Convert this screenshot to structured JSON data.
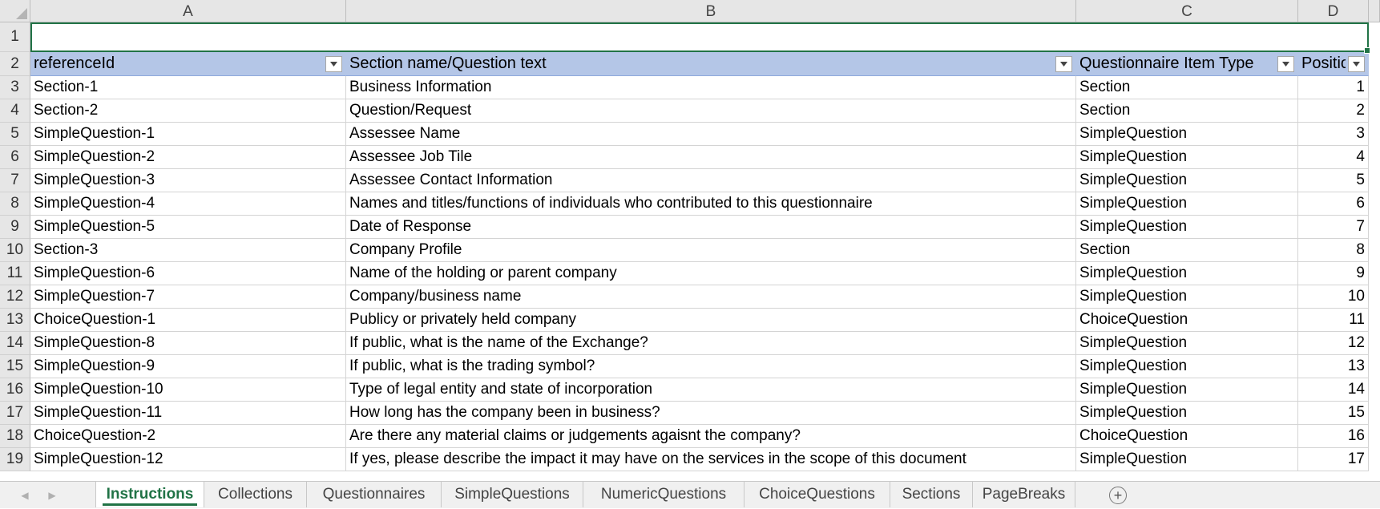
{
  "columns": [
    "A",
    "B",
    "C",
    "D"
  ],
  "header_row": {
    "row_number": "2",
    "cells": [
      "referenceId",
      "Section name/Question text",
      "Questionnaire Item Type",
      "Position"
    ]
  },
  "row1_number": "1",
  "rows": [
    {
      "n": "3",
      "ref": "Section-1",
      "text": "Business Information",
      "type": "Section",
      "pos": "1"
    },
    {
      "n": "4",
      "ref": "Section-2",
      "text": "Question/Request",
      "type": "Section",
      "pos": "2"
    },
    {
      "n": "5",
      "ref": "SimpleQuestion-1",
      "text": "Assessee Name",
      "type": "SimpleQuestion",
      "pos": "3"
    },
    {
      "n": "6",
      "ref": "SimpleQuestion-2",
      "text": "Assessee Job Tile",
      "type": "SimpleQuestion",
      "pos": "4"
    },
    {
      "n": "7",
      "ref": "SimpleQuestion-3",
      "text": "Assessee Contact Information",
      "type": "SimpleQuestion",
      "pos": "5"
    },
    {
      "n": "8",
      "ref": "SimpleQuestion-4",
      "text": "Names and titles/functions of individuals who contributed to this questionnaire",
      "type": "SimpleQuestion",
      "pos": "6"
    },
    {
      "n": "9",
      "ref": "SimpleQuestion-5",
      "text": "Date of Response",
      "type": "SimpleQuestion",
      "pos": "7"
    },
    {
      "n": "10",
      "ref": "Section-3",
      "text": "Company Profile",
      "type": "Section",
      "pos": "8"
    },
    {
      "n": "11",
      "ref": "SimpleQuestion-6",
      "text": "Name of the holding or parent company",
      "type": "SimpleQuestion",
      "pos": "9"
    },
    {
      "n": "12",
      "ref": "SimpleQuestion-7",
      "text": "Company/business name",
      "type": "SimpleQuestion",
      "pos": "10"
    },
    {
      "n": "13",
      "ref": "ChoiceQuestion-1",
      "text": "Publicy or privately held company",
      "type": "ChoiceQuestion",
      "pos": "11"
    },
    {
      "n": "14",
      "ref": "SimpleQuestion-8",
      "text": "If public, what is the name of the Exchange?",
      "type": "SimpleQuestion",
      "pos": "12"
    },
    {
      "n": "15",
      "ref": "SimpleQuestion-9",
      "text": "If public, what is the trading symbol?",
      "type": "SimpleQuestion",
      "pos": "13"
    },
    {
      "n": "16",
      "ref": "SimpleQuestion-10",
      "text": "Type of legal entity and state of incorporation",
      "type": "SimpleQuestion",
      "pos": "14"
    },
    {
      "n": "17",
      "ref": "SimpleQuestion-11",
      "text": "How long has the company been in business?",
      "type": "SimpleQuestion",
      "pos": "15"
    },
    {
      "n": "18",
      "ref": "ChoiceQuestion-2",
      "text": "Are there any material claims or judgements agaisnt the company?",
      "type": "ChoiceQuestion",
      "pos": "16"
    },
    {
      "n": "19",
      "ref": "SimpleQuestion-12",
      "text": "If yes, please describe the impact it may have on the services in the scope of this document",
      "type": "SimpleQuestion",
      "pos": "17"
    }
  ],
  "sheet_tabs": [
    {
      "label": "Instructions",
      "active": true
    },
    {
      "label": "Collections",
      "active": false
    },
    {
      "label": "Questionnaires",
      "active": false
    },
    {
      "label": "SimpleQuestions",
      "active": false
    },
    {
      "label": "NumericQuestions",
      "active": false
    },
    {
      "label": "ChoiceQuestions",
      "active": false
    },
    {
      "label": "Sections",
      "active": false
    },
    {
      "label": "PageBreaks",
      "active": false
    }
  ],
  "add_sheet_symbol": "+",
  "icons": {
    "filter": "filter-dropdown-icon",
    "nav_prev": "sheet-nav-prev-icon",
    "nav_next": "sheet-nav-next-icon",
    "add_sheet": "add-sheet-icon"
  },
  "colors": {
    "accent": "#217346",
    "table_header": "#b4c6e7",
    "grid_header": "#e6e6e6"
  }
}
